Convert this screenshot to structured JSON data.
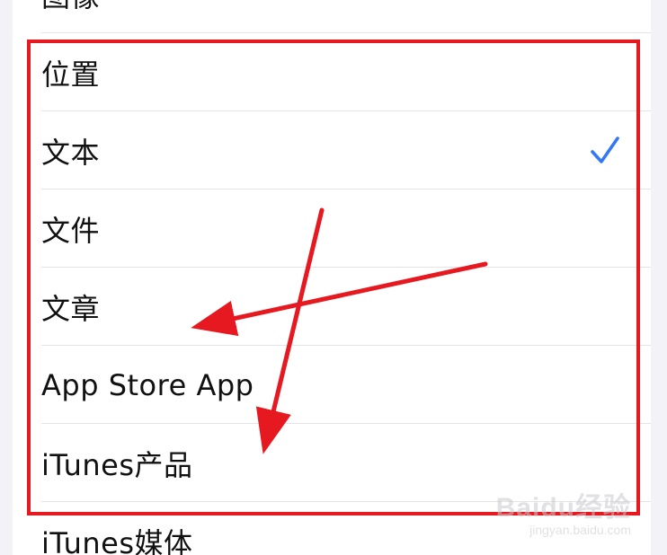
{
  "list": {
    "items": [
      {
        "label": "图像",
        "checked": false
      },
      {
        "label": "位置",
        "checked": false
      },
      {
        "label": "文本",
        "checked": true
      },
      {
        "label": "文件",
        "checked": false
      },
      {
        "label": "文章",
        "checked": false
      },
      {
        "label": "App Store App",
        "checked": false
      },
      {
        "label": "iTunes产品",
        "checked": false
      },
      {
        "label": "iTunes媒体",
        "checked": false
      }
    ]
  },
  "colors": {
    "check": "#3478f6",
    "annotation": "#e5191f",
    "background": "#f2f2f7"
  },
  "watermark": {
    "main": "Baidu经验",
    "sub": "jingyan.baidu.com"
  }
}
